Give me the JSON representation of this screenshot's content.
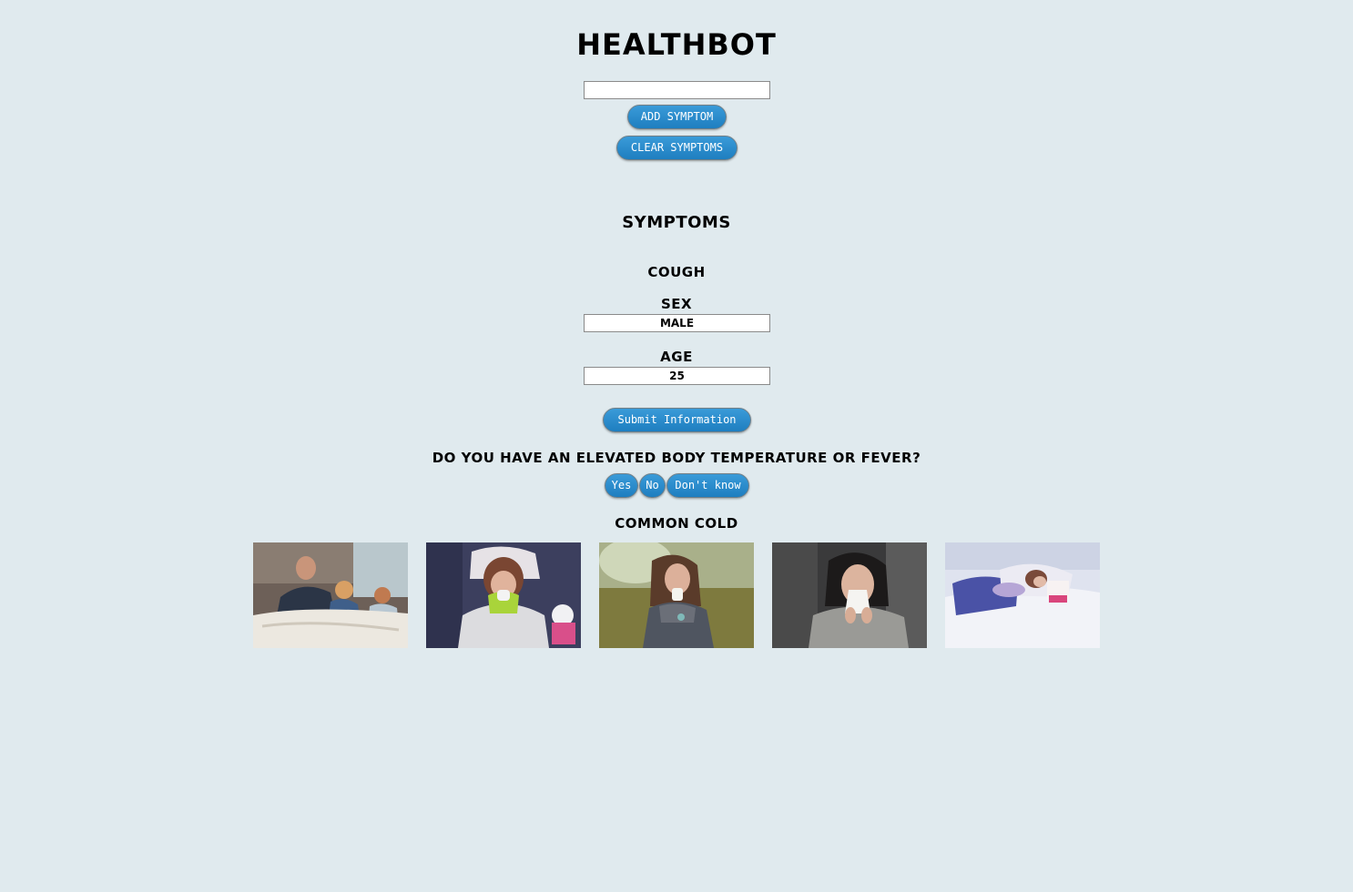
{
  "app": {
    "title": "HEALTHBOT"
  },
  "symptom_entry": {
    "value": "",
    "add_label": "ADD SYMPTOM",
    "clear_label": "CLEAR SYMPTOMS"
  },
  "symptoms": {
    "heading": "SYMPTOMS",
    "items": [
      "COUGH"
    ]
  },
  "profile": {
    "sex_label": "SEX",
    "sex_value": "MALE",
    "age_label": "AGE",
    "age_value": "25",
    "submit_label": "Submit Information"
  },
  "question": {
    "text": "DO YOU HAVE AN ELEVATED BODY TEMPERATURE OR FEVER?",
    "options": [
      "Yes",
      "No",
      "Don't know"
    ]
  },
  "result": {
    "condition": "COMMON COLD",
    "images": [
      {
        "subject": "father-with-children-in-bed"
      },
      {
        "subject": "woman-blowing-nose-on-couch"
      },
      {
        "subject": "woman-with-tissue-outdoors"
      },
      {
        "subject": "woman-sneezing-into-tissue"
      },
      {
        "subject": "woman-lying-in-bed-sick"
      }
    ]
  },
  "colors": {
    "background": "#e0eaee",
    "button": "#2285c9",
    "button_text": "#ffffff"
  }
}
